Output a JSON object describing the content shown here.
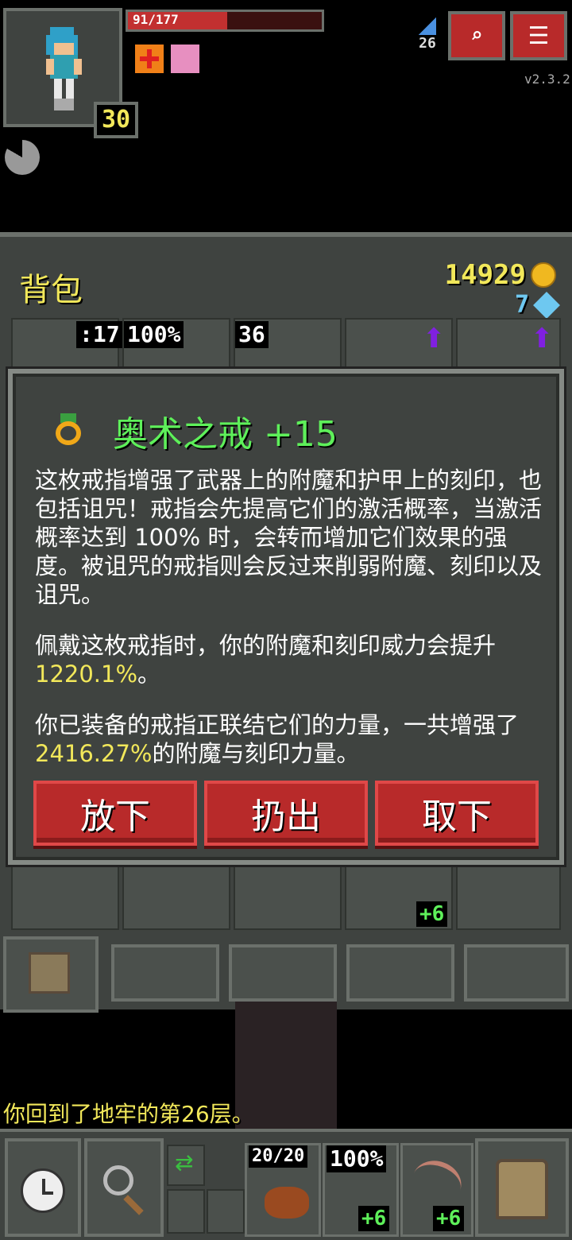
{
  "status": {
    "hp_text": "91/177",
    "hp_fraction": 0.514,
    "level": "30",
    "depth": "26",
    "version": "v2.3.2"
  },
  "inventory": {
    "title": "背包",
    "gold": "14929",
    "energy": "7",
    "row1_labels": {
      "slot1": ":17",
      "slot2": "100%",
      "slot3": "36"
    },
    "row3_label": "+6"
  },
  "item_window": {
    "name": "奥术之戒 +15",
    "desc_p1": "这枚戒指增强了武器上的附魔和护甲上的刻印，也包括诅咒！戒指会先提高它们的激活概率，当激活概率达到 100% 时，会转而增加它们效果的强度。被诅咒的戒指则会反过来削弱附魔、刻印以及诅咒。",
    "desc_p2_a": "佩戴这枚戒指时，你的附魔和刻印威力会提升 ",
    "desc_p2_val": "1220.1%",
    "desc_p2_b": "。",
    "desc_p3_a": "你已装备的戒指正联结它们的力量，一共增强了",
    "desc_p3_val": "2416.27%",
    "desc_p3_b": "的附魔与刻印力量。",
    "buttons": {
      "drop": "放下",
      "throw": "扔出",
      "unequip": "取下"
    }
  },
  "log": {
    "message": "你回到了地牢的第26层。"
  },
  "toolbar": {
    "quick1_label": "20/20",
    "quick2_label": "100%",
    "quick2_plus": "+6",
    "quick3_plus": "+6"
  },
  "colors": {
    "accent_green": "#5ef05a",
    "highlight_yellow": "#f2e85a",
    "button_red": "#b82a2a",
    "hp_red": "#c23030",
    "panel_stone": "#3f4340"
  }
}
